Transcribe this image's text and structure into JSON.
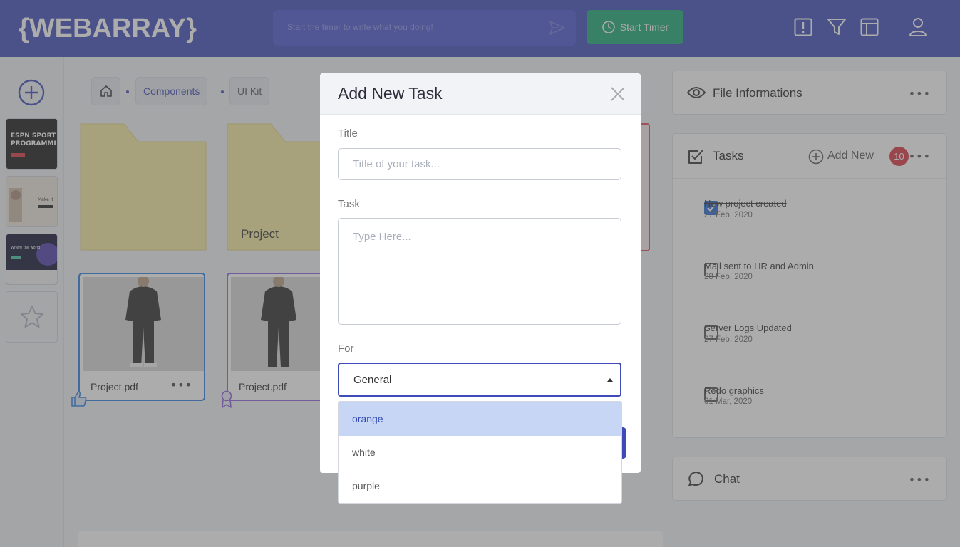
{
  "header": {
    "logo": "{WEBARRAY}",
    "timer_placeholder": "Start the timer to write what you doing!",
    "start_timer_label": "Start Timer"
  },
  "breadcrumb": {
    "items": [
      "Components",
      "UI Kit"
    ]
  },
  "folders": [
    {
      "label": ""
    },
    {
      "label": "Project"
    }
  ],
  "files": [
    {
      "name": "Project.pdf"
    },
    {
      "name": "Project.pdf"
    }
  ],
  "panels": {
    "file_info_title": "File Informations",
    "tasks_title": "Tasks",
    "add_new_label": "Add New",
    "tasks_count": "10",
    "chat_title": "Chat"
  },
  "tasks": [
    {
      "title": "New project created",
      "date": "27 Feb, 2020",
      "done": true
    },
    {
      "title": "Mail sent to HR and Admin",
      "date": "28 Feb, 2020",
      "done": false
    },
    {
      "title": "Server Logs Updated",
      "date": "27 Feb, 2020",
      "done": false
    },
    {
      "title": "Redo graphics",
      "date": "01 Mar, 2020",
      "done": false
    }
  ],
  "modal": {
    "title": "Add New Task",
    "title_label": "Title",
    "title_placeholder": "Title of your task...",
    "task_label": "Task",
    "task_placeholder": "Type Here...",
    "for_label": "For",
    "for_value": "General",
    "options": [
      "orange",
      "white",
      "purple"
    ],
    "active_option": "orange"
  },
  "colors": {
    "brand": "#3d4ab8",
    "timer_button": "#17a672",
    "badge": "#d8343f",
    "checkbox_checked": "#2269d8",
    "dropdown_active": "#c8d6f5"
  }
}
